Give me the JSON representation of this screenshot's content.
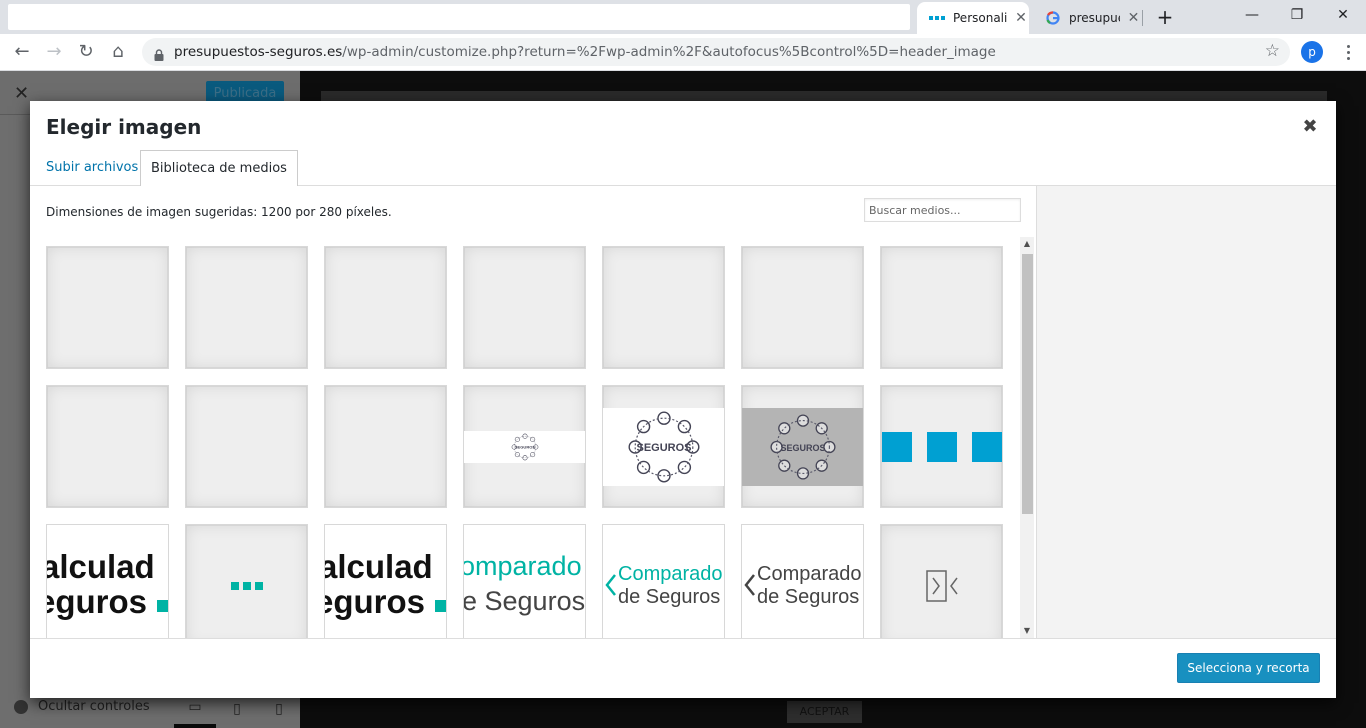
{
  "browser": {
    "tabs": [
      {
        "title": "Personaliz",
        "active": true
      },
      {
        "title": "presupues",
        "active": false
      }
    ],
    "url_host": "presupuestos-seguros.es",
    "url_path": "/wp-admin/customize.php?return=%2Fwp-admin%2F&autofocus%5Bcontrol%5D=header_image",
    "profile_initial": "p"
  },
  "background": {
    "publish_label": "Publicada",
    "hide_controls_label": "Ocultar controles",
    "accept_label": "ACEPTAR"
  },
  "modal": {
    "title": "Elegir imagen",
    "tabs": {
      "upload": "Subir archivos",
      "library": "Biblioteca de medios"
    },
    "hint": "Dimensiones de imagen sugeridas: 1200 por 280 píxeles.",
    "search_placeholder": "Buscar medios...",
    "select_button": "Selecciona y recorta",
    "thumbnails": [
      {
        "kind": "blank"
      },
      {
        "kind": "blank"
      },
      {
        "kind": "blank"
      },
      {
        "kind": "blank"
      },
      {
        "kind": "blank"
      },
      {
        "kind": "blank"
      },
      {
        "kind": "blank"
      },
      {
        "kind": "blank"
      },
      {
        "kind": "blank"
      },
      {
        "kind": "blank"
      },
      {
        "kind": "seguros-small"
      },
      {
        "kind": "seguros-white"
      },
      {
        "kind": "seguros-grey"
      },
      {
        "kind": "blue-squares"
      },
      {
        "kind": "calculad"
      },
      {
        "kind": "teal-dots"
      },
      {
        "kind": "calculad"
      },
      {
        "kind": "comparador-teal"
      },
      {
        "kind": "comparador-arrow-teal"
      },
      {
        "kind": "comparador-arrow-dark"
      },
      {
        "kind": "brackets"
      }
    ],
    "thumb_texts": {
      "seguros": "SEGUROS",
      "calculad_1": "alculad",
      "calculad_2": "eguros",
      "comparador_1": "omparado",
      "comparador_2": "e Seguros",
      "comparador_b1": "Comparado",
      "comparador_b2": "de Seguros"
    }
  },
  "colors": {
    "accent": "#0073aa",
    "teal": "#00b3a4",
    "blue": "#00a0d2"
  }
}
